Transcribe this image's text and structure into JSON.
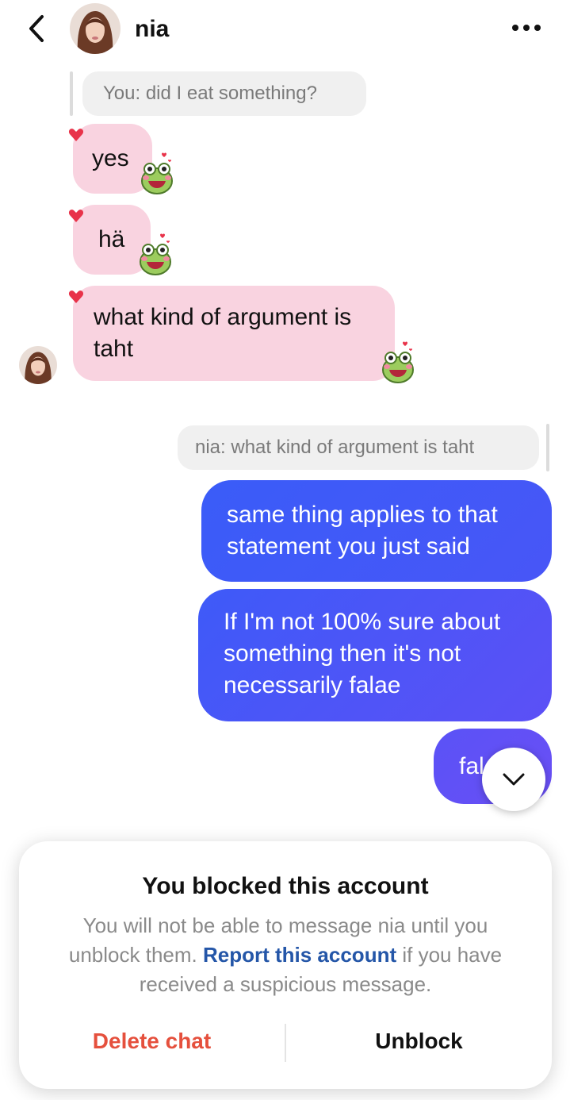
{
  "header": {
    "contact_name": "nia",
    "back_icon": "chevron-left-icon",
    "more_icon": "ellipsis-icon"
  },
  "messages": {
    "reply_quote_1": "You: did I eat something?",
    "incoming": [
      "yes",
      "hä",
      "what kind of argument is taht"
    ],
    "reply_quote_2": "nia: what kind of argument is taht",
    "outgoing": [
      "same thing applies to that statement you just said",
      "If I'm not 100% sure about something then it's not necessarily falae",
      "fal"
    ]
  },
  "blocked_notice": {
    "title": "You blocked this account",
    "description_start": "You will not be able to message nia until you unblock them. ",
    "report_link": "Report this account",
    "description_end": " if you have received a suspicious message.",
    "delete_label": "Delete chat",
    "unblock_label": "Unblock"
  },
  "colors": {
    "incoming_bubble": "#f9d3e0",
    "outgoing_gradient_start": "#3a5cf8",
    "outgoing_gradient_end": "#6a4ff5",
    "heart": "#e8334a",
    "delete": "#e5503d",
    "link": "#2456a8"
  }
}
